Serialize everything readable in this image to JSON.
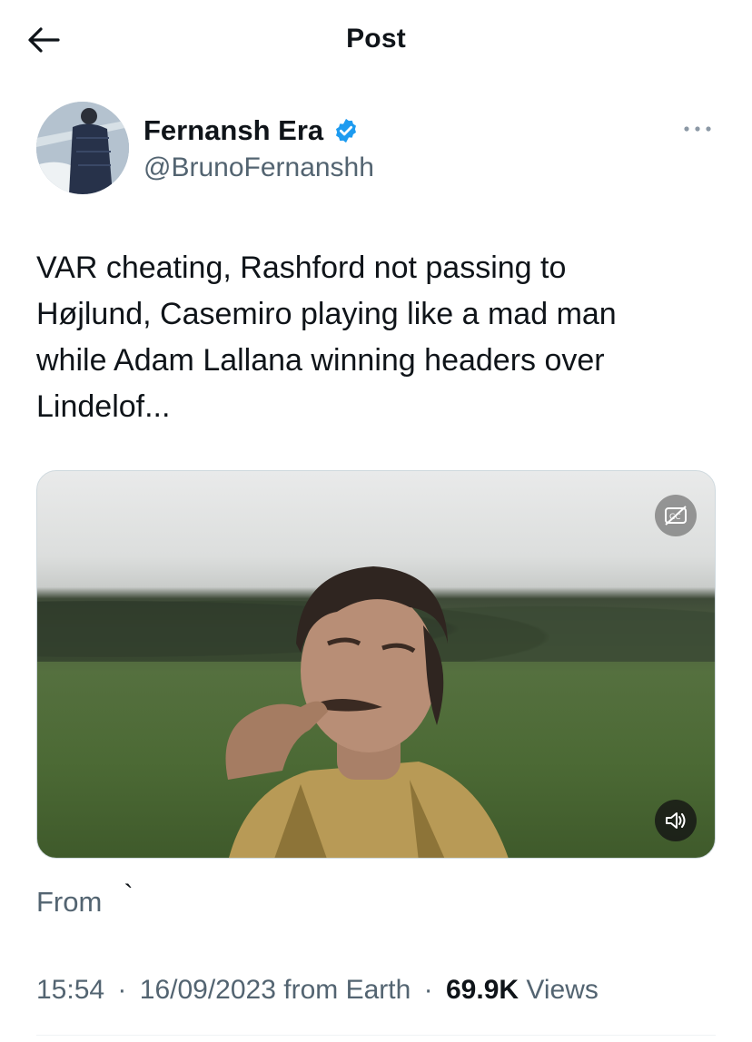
{
  "header": {
    "title": "Post",
    "back_icon": "arrow-left-icon"
  },
  "author": {
    "display_name": "Fernansh Era",
    "handle": "@BrunoFernanshh",
    "verified_badge_color": "#1d9bf0",
    "more_icon": "more-horizontal-icon"
  },
  "tweet": {
    "text": "VAR cheating, Rashford not passing to\nHøjlund, Casemiro playing like a mad man\nwhile Adam Lallana winning headers over\nLindelof..."
  },
  "media": {
    "captions_icon": "captions-off-icon",
    "volume_icon": "volume-muted-icon"
  },
  "source": {
    "label": "From",
    "mark": "`"
  },
  "meta": {
    "time": "15:54",
    "date": "16/09/2023",
    "origin": "from Earth",
    "separator": "·",
    "views_count": "69.9K",
    "views_label": "Views"
  },
  "colors": {
    "text": "#0f1419",
    "secondary": "#536471",
    "accent": "#1d9bf0"
  }
}
